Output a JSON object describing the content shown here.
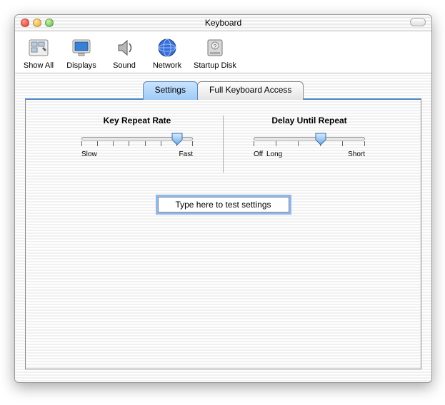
{
  "window": {
    "title": "Keyboard"
  },
  "toolbar": {
    "items": [
      {
        "label": "Show All",
        "icon": "show-all"
      },
      {
        "label": "Displays",
        "icon": "displays"
      },
      {
        "label": "Sound",
        "icon": "sound"
      },
      {
        "label": "Network",
        "icon": "network"
      },
      {
        "label": "Startup Disk",
        "icon": "startup-disk"
      }
    ]
  },
  "tabs": [
    {
      "label": "Settings",
      "active": true
    },
    {
      "label": "Full Keyboard Access",
      "active": false
    }
  ],
  "sliders": {
    "keyRepeat": {
      "title": "Key Repeat Rate",
      "leftLabel": "Slow",
      "rightLabel": "Fast",
      "ticks": 8,
      "valueIndex": 6
    },
    "delay": {
      "title": "Delay Until Repeat",
      "leftLabel": "Off",
      "midLabel": "Long",
      "rightLabel": "Short",
      "ticks": 6,
      "valueIndex": 3
    }
  },
  "testField": {
    "placeholder": "Type here to test settings",
    "value": "Type here to test settings"
  }
}
